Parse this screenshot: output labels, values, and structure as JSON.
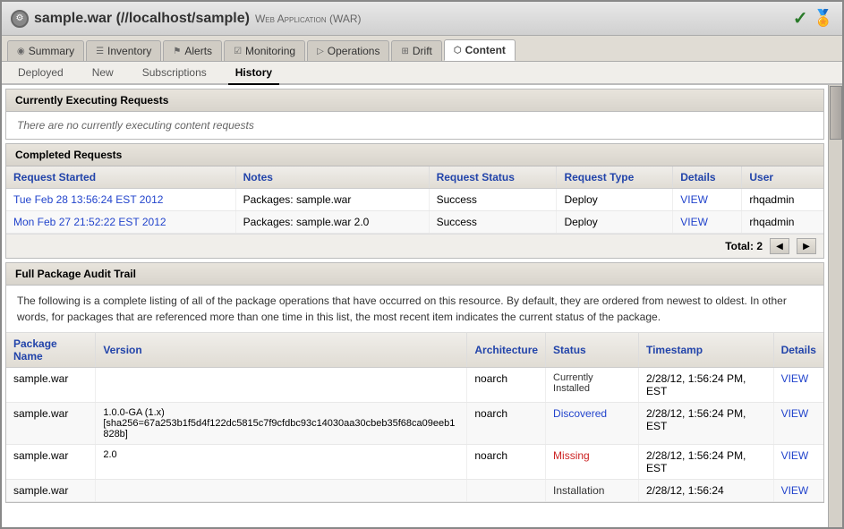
{
  "titleBar": {
    "icon": "⚙",
    "mainTitle": "sample.war (//localhost/sample)",
    "subTitle": "Web Application (WAR)",
    "checkIcon": "✓",
    "medalIcon": "🏅"
  },
  "tabs": [
    {
      "id": "summary",
      "label": "Summary",
      "icon": "◉",
      "active": false
    },
    {
      "id": "inventory",
      "label": "Inventory",
      "icon": "☰",
      "active": false
    },
    {
      "id": "alerts",
      "label": "Alerts",
      "icon": "⚑",
      "active": false
    },
    {
      "id": "monitoring",
      "label": "Monitoring",
      "icon": "☑",
      "active": false
    },
    {
      "id": "operations",
      "label": "Operations",
      "icon": "▷",
      "active": false
    },
    {
      "id": "drift",
      "label": "Drift",
      "icon": "⊞",
      "active": false
    },
    {
      "id": "content",
      "label": "Content",
      "icon": "⬡",
      "active": true
    }
  ],
  "subtabs": [
    {
      "id": "deployed",
      "label": "Deployed",
      "active": false
    },
    {
      "id": "new",
      "label": "New",
      "active": false
    },
    {
      "id": "subscriptions",
      "label": "Subscriptions",
      "active": false
    },
    {
      "id": "history",
      "label": "History",
      "active": true
    }
  ],
  "currentlyExecuting": {
    "header": "Currently Executing Requests",
    "noRequestsText": "There are no currently executing content requests"
  },
  "completedRequests": {
    "header": "Completed Requests",
    "columns": [
      "Request Started",
      "Notes",
      "Request Status",
      "Request Type",
      "Details",
      "User"
    ],
    "rows": [
      {
        "requestStarted": "Tue Feb 28 13:56:24 EST 2012",
        "notes": "Packages: sample.war",
        "requestStatus": "Success",
        "requestType": "Deploy",
        "details": "VIEW",
        "user": "rhqadmin"
      },
      {
        "requestStarted": "Mon Feb 27 21:52:22 EST 2012",
        "notes": "Packages: sample.war 2.0",
        "requestStatus": "Success",
        "requestType": "Deploy",
        "details": "VIEW",
        "user": "rhqadmin"
      }
    ],
    "total": "Total: 2"
  },
  "auditTrail": {
    "header": "Full Package Audit Trail",
    "description": "The following is a complete listing of all of the package operations that have occurred on this resource. By default, they are ordered from newest to oldest. In other words, for packages that are referenced more than one time in this list, the most recent item indicates the current status of the package.",
    "columns": [
      "Package Name",
      "Version",
      "Architecture",
      "Status",
      "Timestamp",
      "Details"
    ],
    "rows": [
      {
        "packageName": "sample.war",
        "version": "",
        "architecture": "noarch",
        "status": "Currently Installed",
        "statusClass": "status-installed",
        "timestamp": "2/28/12, 1:56:24 PM, EST",
        "details": "VIEW"
      },
      {
        "packageName": "sample.war",
        "version": "1.0.0-GA (1.x)\n[sha256=67a253b1f5d4f122dc5815c7f9cfdbc93c14030aa30cbeb35f68ca09eeb1828b]",
        "architecture": "noarch",
        "status": "Discovered",
        "statusClass": "status-discovered",
        "timestamp": "2/28/12, 1:56:24 PM, EST",
        "details": "VIEW"
      },
      {
        "packageName": "sample.war",
        "version": "2.0",
        "architecture": "noarch",
        "status": "Missing",
        "statusClass": "status-missing",
        "timestamp": "2/28/12, 1:56:24 PM, EST",
        "details": "VIEW"
      },
      {
        "packageName": "sample.war",
        "version": "",
        "architecture": "",
        "status": "Installation",
        "statusClass": "status-installation",
        "timestamp": "2/28/12, 1:56:24",
        "details": "VIEW"
      }
    ]
  }
}
